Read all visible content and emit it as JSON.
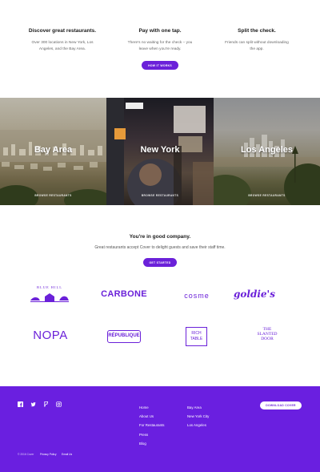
{
  "features": [
    {
      "title": "Discover great restaurants.",
      "text_l1": "Over 300 locations in New York, Los",
      "text_l2": "Angeles, and the Bay Area."
    },
    {
      "title": "Pay with one tap.",
      "text_l1": "There's no waiting for the check – you",
      "text_l2": "leave when you're ready."
    },
    {
      "title": "Split the check.",
      "text_l1": "Friends can split without downloading",
      "text_l2": "the app."
    }
  ],
  "how_button": "HOW IT WORKS",
  "cities": [
    {
      "name": "Bay Area",
      "browse": "BROWSE RESTAURANTS"
    },
    {
      "name": "New York",
      "browse": "BROWSE RESTAURANTS"
    },
    {
      "name": "Los Angeles",
      "browse": "BROWSE RESTAURANTS"
    }
  ],
  "company": {
    "title": "You're in good company.",
    "subtitle": "Great restaurants accept Cover to delight guests and save their staff time.",
    "button": "GET STARTED",
    "logos": {
      "bluehill": "BLUE HILL",
      "carbone": "CARBONE",
      "cosme": "cosme",
      "goldies": "goldie's",
      "nopa": "NOPA",
      "republique": "RÉPUBLIQUE",
      "rich1": "RICH",
      "rich2": "TABLE",
      "slanted1": "THE",
      "slanted2": "SLANTED",
      "slanted3": "DOOR"
    }
  },
  "footer": {
    "social_icons": [
      "facebook-icon",
      "twitter-icon",
      "foursquare-icon",
      "instagram-icon"
    ],
    "links_col1": [
      "Home",
      "About Us",
      "For Restaurants",
      "Press",
      "Blog"
    ],
    "links_col2": [
      "Bay Area",
      "New York City",
      "Los Angeles"
    ],
    "download": "DOWNLOAD COVER",
    "copyright": "© 2016 Cover",
    "privacy": "Privacy Policy",
    "email": "Email Us"
  },
  "colors": {
    "accent": "#6b21d9",
    "footer_bg": "#6a1fe0"
  }
}
